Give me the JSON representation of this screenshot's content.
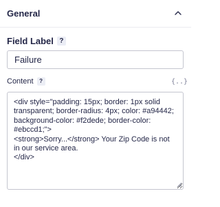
{
  "section": {
    "title": "General",
    "collapse_icon": "chevron-up-icon"
  },
  "field_label": {
    "label": "Field Label",
    "help": "?",
    "value": "Failure"
  },
  "content": {
    "label": "Content",
    "help": "?",
    "merge_tag_icon": "{..}",
    "value": "<div style=\"padding: 15px; border: 1px solid transparent; border-radius: 4px; color: #a94442; background-color: #f2dede; border-color: #ebccd1;\">\n<strong>Sorry...</strong> Your Zip Code is not in our service area.\n</div>"
  },
  "colors": {
    "text": "#242748",
    "border": "#c4c5cf",
    "help_bg": "#ebedf5"
  }
}
